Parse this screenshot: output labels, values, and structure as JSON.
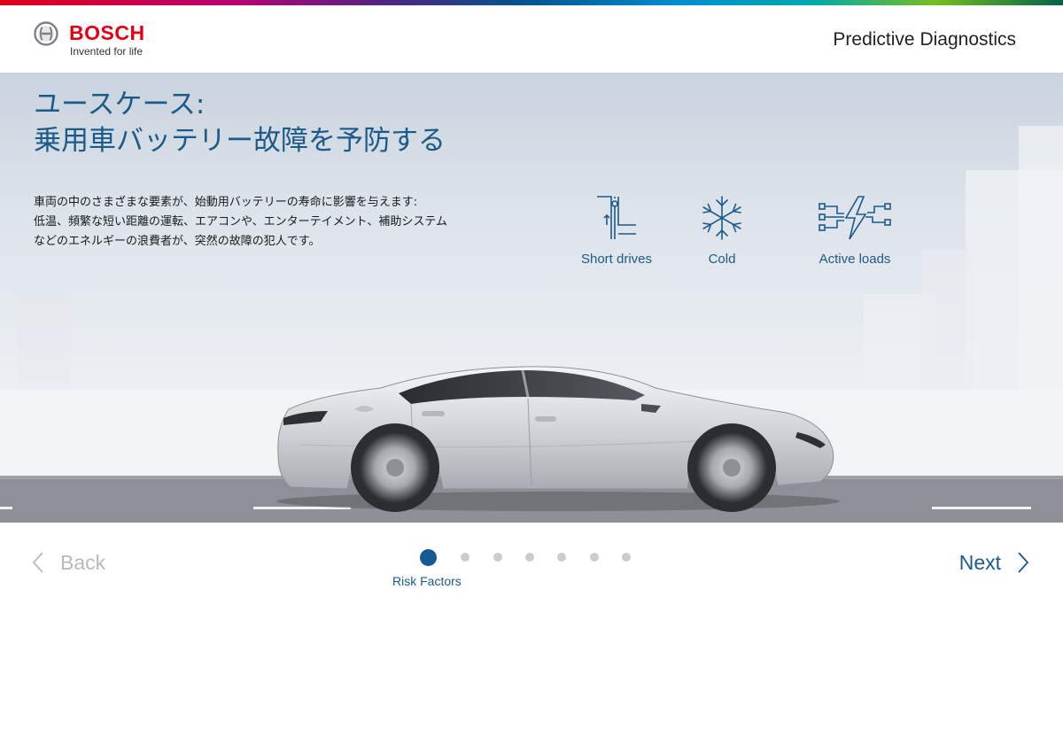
{
  "header": {
    "brand": "BOSCH",
    "tagline": "Invented for life",
    "app_title": "Predictive Diagnostics"
  },
  "hero": {
    "headline_line1": "ユースケース:",
    "headline_line2": "乗用車バッテリー故障を予防する",
    "description_lines": [
      "車両の中のさまざまな要素が、始動用バッテリーの寿命に影響を与えます:",
      "低温、頻繁な短い距離の運転、エアコンや、エンターテイメント、補助システム",
      "などのエネルギーの浪費者が、突然の故障の犯人です。"
    ],
    "factors": [
      {
        "icon": "short-drives-icon",
        "label": "Short drives"
      },
      {
        "icon": "snowflake-icon",
        "label": "Cold"
      },
      {
        "icon": "active-loads-icon",
        "label": "Active loads"
      }
    ]
  },
  "navigation": {
    "back_label": "Back",
    "next_label": "Next",
    "current_step_label": "Risk Factors",
    "total_steps": 7,
    "current_step": 1
  },
  "colors": {
    "brand_red": "#e20015",
    "accent_blue": "#1c5a8a",
    "active_dot": "#165a93",
    "inactive_dot": "#c9ccd0",
    "disabled_text": "#b6bac0"
  }
}
